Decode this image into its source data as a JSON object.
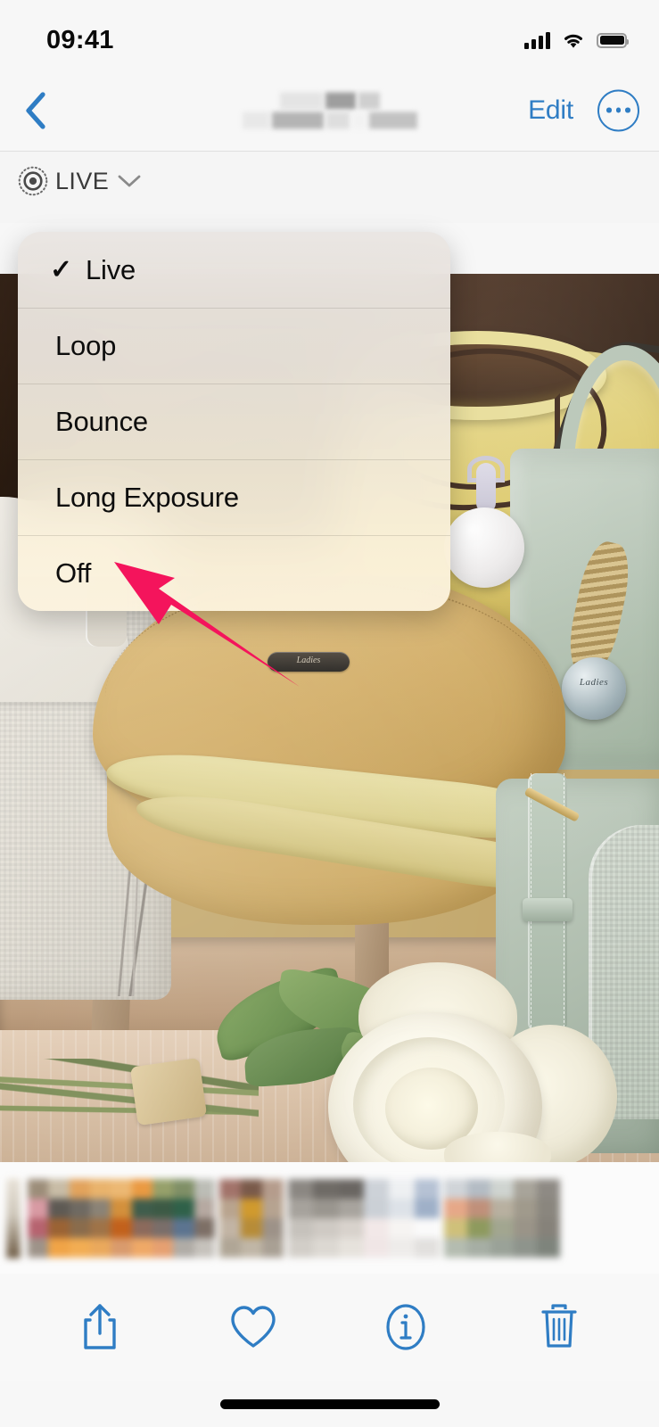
{
  "status_bar": {
    "time": "09:41",
    "cellular_icon": "signal-bars-icon",
    "wifi_icon": "wifi-icon",
    "battery_icon": "battery-full-icon"
  },
  "nav_bar": {
    "back_icon": "chevron-left-icon",
    "title": "",
    "title_redacted": true,
    "edit_label": "Edit",
    "more_icon": "ellipsis-circle-icon",
    "accent_color": "#2f7dc4"
  },
  "live_badge": {
    "icon": "live-photo-icon",
    "label": "LIVE",
    "chevron_icon": "chevron-down-icon",
    "text_color": "#3b3b3b"
  },
  "effects_menu": {
    "selected": "Live",
    "check_glyph": "✓",
    "items": [
      {
        "label": "Live",
        "checked": true
      },
      {
        "label": "Loop",
        "checked": false
      },
      {
        "label": "Bounce",
        "checked": false
      },
      {
        "label": "Long Exposure",
        "checked": false
      },
      {
        "label": "Off",
        "checked": false
      }
    ]
  },
  "annotation": {
    "arrow_color": "#F4145C",
    "points_at": "Off",
    "direction": "up-left"
  },
  "photo": {
    "description": "Handbags on a store display shelf with white roses",
    "subjects": [
      "tan saddle bag",
      "yellow tote bag",
      "sage green handbag",
      "cream canvas bag",
      "white roses bouquet"
    ]
  },
  "filmstrip": {
    "blurred": true,
    "selected_index": 0
  },
  "bottom_toolbar": {
    "icon_color": "#2f7dc4",
    "buttons": [
      {
        "name": "share",
        "icon": "share-icon"
      },
      {
        "name": "favorite",
        "icon": "heart-icon"
      },
      {
        "name": "info",
        "icon": "info-circle-icon"
      },
      {
        "name": "delete",
        "icon": "trash-icon"
      }
    ]
  },
  "home_indicator": {
    "visible": true
  }
}
